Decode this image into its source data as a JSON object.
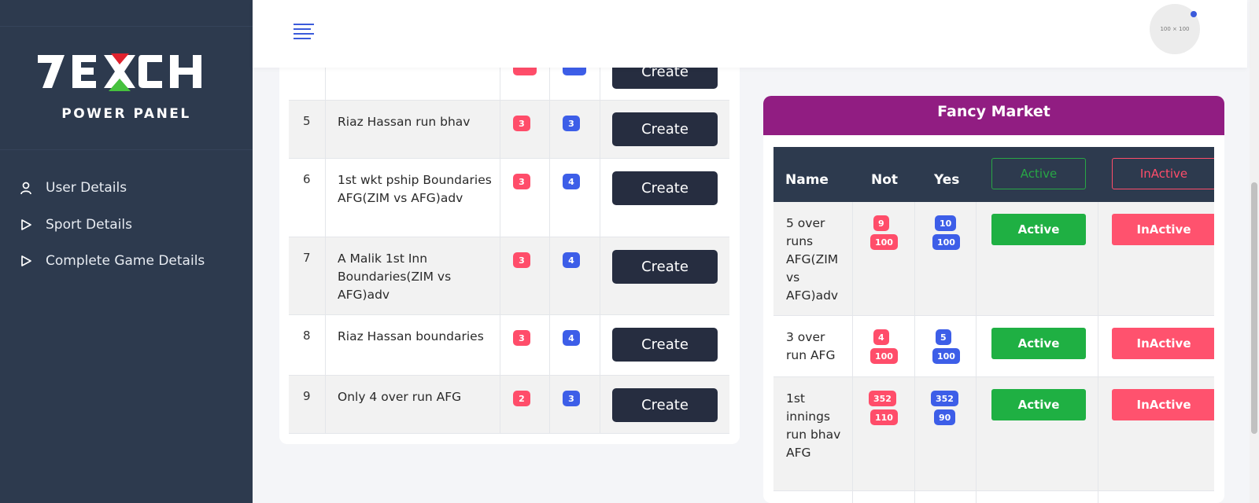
{
  "brand": {
    "logo_text": "7EXCH",
    "panel_title": "POWER PANEL"
  },
  "sidebar": {
    "items": [
      {
        "label": "User Details",
        "icon": "user-icon"
      },
      {
        "label": "Sport Details",
        "icon": "play-icon"
      },
      {
        "label": "Complete Game Details",
        "icon": "play-icon"
      }
    ]
  },
  "header": {
    "avatar_text": "100 × 100"
  },
  "market_list": {
    "button_label": "Create",
    "rows": [
      {
        "num": "",
        "name": "",
        "red": "",
        "blue": ""
      },
      {
        "num": "5",
        "name": "Riaz Hassan run bhav",
        "red": "3",
        "blue": "3"
      },
      {
        "num": "6",
        "name": "1st wkt pship Boundaries AFG(ZIM vs AFG)adv",
        "red": "3",
        "blue": "4"
      },
      {
        "num": "7",
        "name": "A Malik 1st Inn Boundaries(ZIM vs AFG)adv",
        "red": "3",
        "blue": "4"
      },
      {
        "num": "8",
        "name": "Riaz Hassan boundaries",
        "red": "3",
        "blue": "4"
      },
      {
        "num": "9",
        "name": "Only 4 over run AFG",
        "red": "2",
        "blue": "3"
      }
    ]
  },
  "fancy_market": {
    "title": "Fancy Market",
    "columns": {
      "name": "Name",
      "not": "Not",
      "yes": "Yes",
      "active": "Active",
      "inactive": "InActive"
    },
    "rows": [
      {
        "name": "5 over runs AFG(ZIM vs AFG)adv",
        "not_top": "9",
        "not_bottom": "100",
        "yes_top": "10",
        "yes_bottom": "100",
        "active_label": "Active",
        "inactive_label": "InActive"
      },
      {
        "name": "3 over run AFG",
        "not_top": "4",
        "not_bottom": "100",
        "yes_top": "5",
        "yes_bottom": "100",
        "active_label": "Active",
        "inactive_label": "InActive"
      },
      {
        "name": "1st innings run bhav AFG",
        "not_top": "352",
        "not_bottom": "110",
        "yes_top": "352",
        "yes_bottom": "90",
        "active_label": "Active",
        "inactive_label": "InActive"
      }
    ]
  },
  "colors": {
    "sidebar": "#2d3a4e",
    "accent": "#3b5bdb",
    "fancy_header": "#911d82",
    "green": "#1fb043",
    "red": "#ff526e"
  }
}
